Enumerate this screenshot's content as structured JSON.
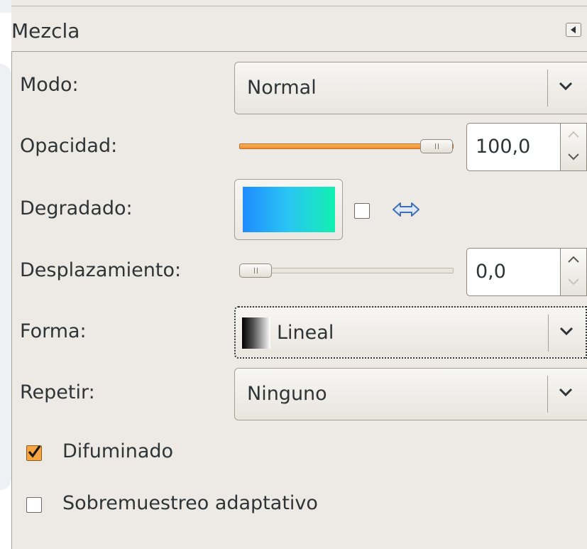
{
  "panel": {
    "title": "Mezcla"
  },
  "fields": {
    "modo": {
      "label": "Modo:",
      "value": "Normal"
    },
    "opacidad": {
      "label": "Opacidad:",
      "value": "100,0",
      "fraction": 1.0
    },
    "degradado": {
      "label": "Degradado:",
      "reverse_checked": false
    },
    "desplazamiento": {
      "label": "Desplazamiento:",
      "value": "0,0",
      "fraction": 0.0
    },
    "forma": {
      "label": "Forma:",
      "value": "Lineal"
    },
    "repetir": {
      "label": "Repetir:",
      "value": "Ninguno"
    }
  },
  "options": {
    "difuminado": {
      "label": "Difuminado",
      "checked": true
    },
    "sobremuestreo": {
      "label": "Sobremuestreo adaptativo",
      "checked": false
    }
  },
  "colors": {
    "accent": "#f08f2e",
    "gradient_start": "#1f8cff",
    "gradient_end": "#11f0b0"
  },
  "icons": {
    "panel_menu": "panel-menu-icon",
    "swap": "swap-arrows-icon",
    "dropdown": "chevron-down-icon"
  }
}
